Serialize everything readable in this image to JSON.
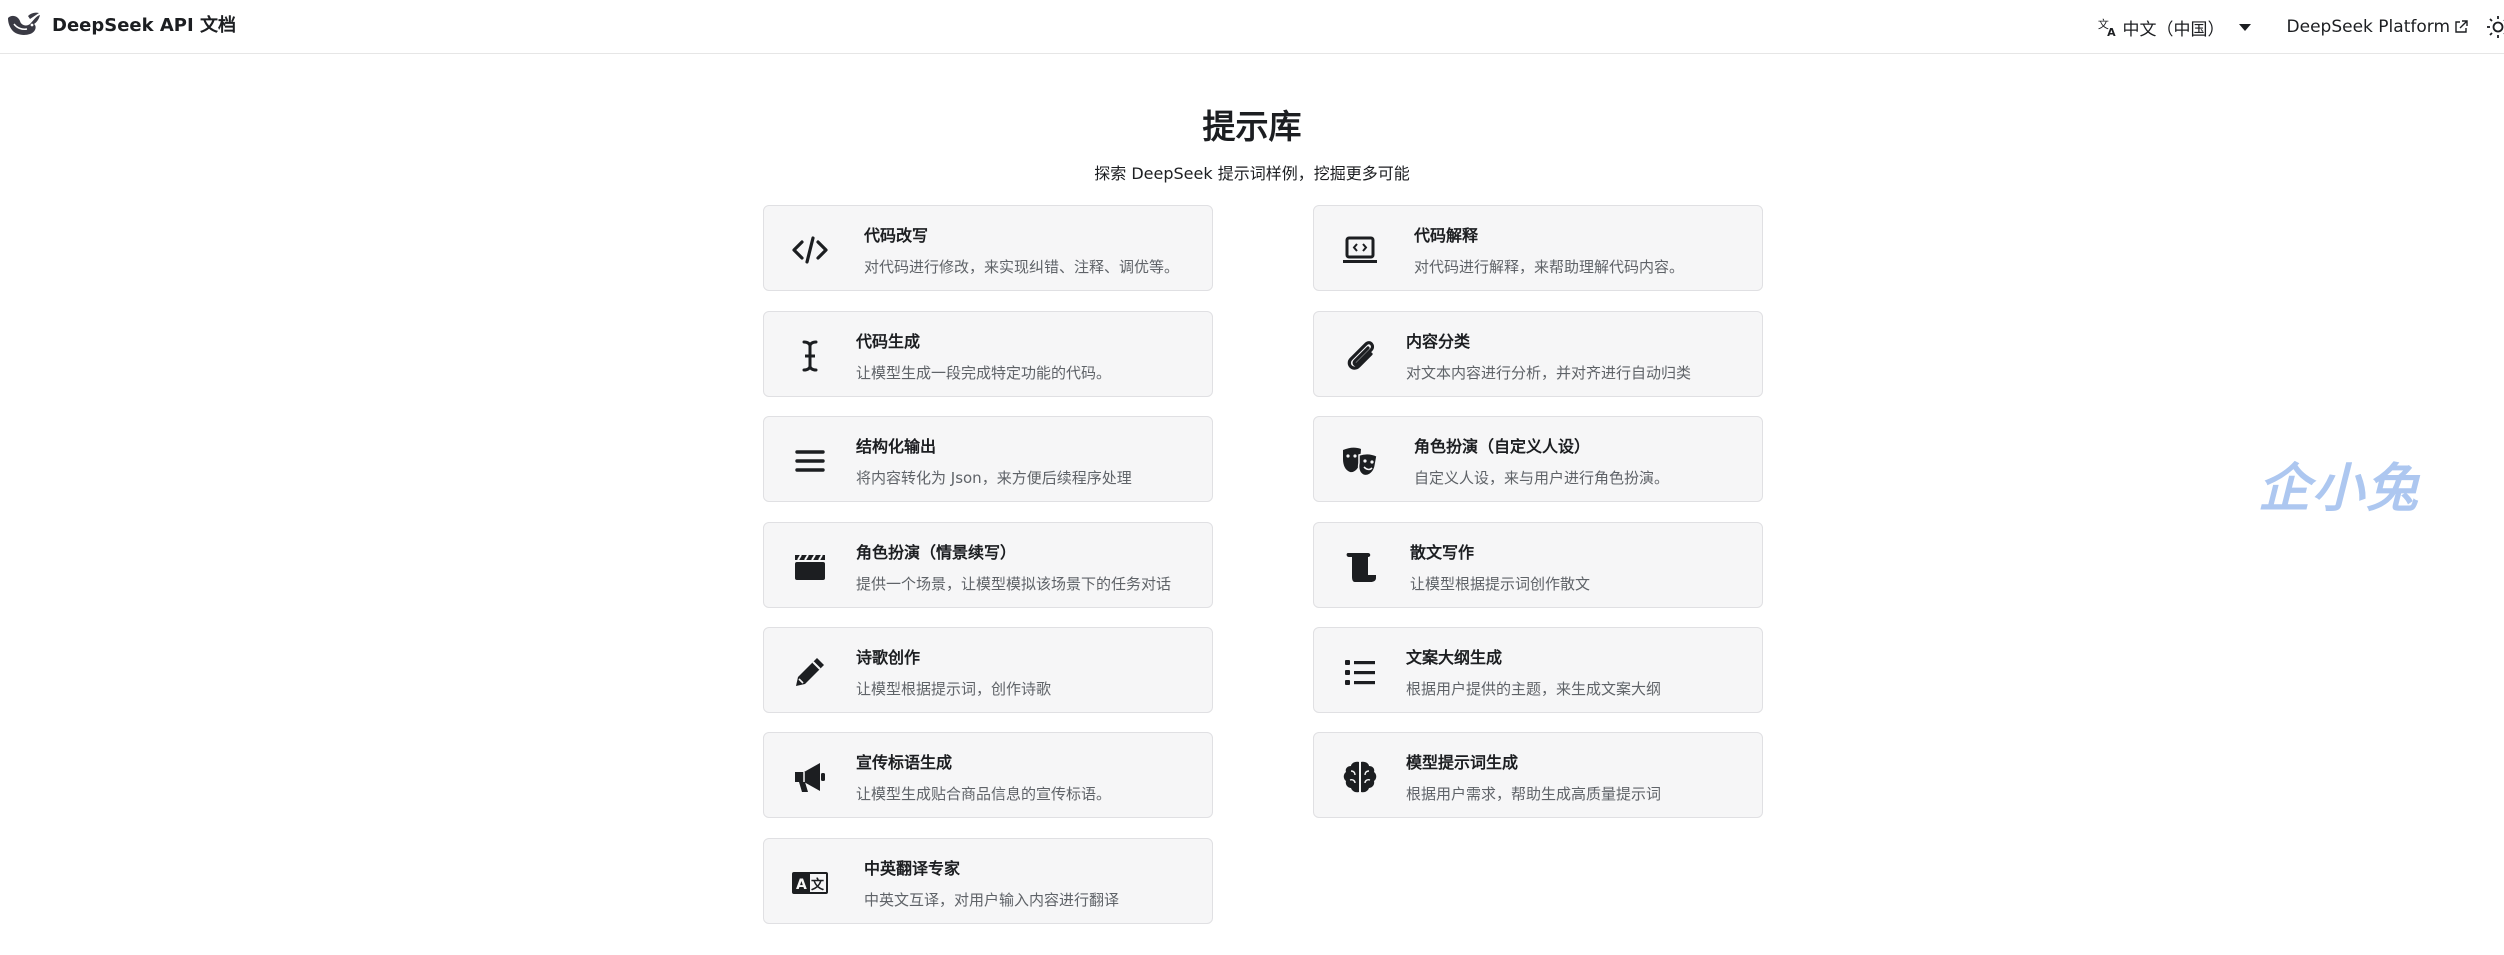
{
  "navbar": {
    "brand_title": "DeepSeek API 文档",
    "lang_label": "中文（中国）",
    "platform_label": "DeepSeek Platform"
  },
  "header": {
    "title": "提示库",
    "subtitle": "探索 DeepSeek 提示词样例，挖掘更多可能"
  },
  "cards": [
    {
      "title": "代码改写",
      "desc": "对代码进行修改，来实现纠错、注释、调优等。",
      "icon": "code-icon"
    },
    {
      "title": "代码解释",
      "desc": "对代码进行解释，来帮助理解代码内容。",
      "icon": "laptop-code-icon"
    },
    {
      "title": "代码生成",
      "desc": "让模型生成一段完成特定功能的代码。",
      "icon": "text-cursor-icon"
    },
    {
      "title": "内容分类",
      "desc": "对文本内容进行分析，并对齐进行自动归类",
      "icon": "paperclip-icon"
    },
    {
      "title": "结构化输出",
      "desc": "将内容转化为 Json，来方便后续程序处理",
      "icon": "menu-icon"
    },
    {
      "title": "角色扮演（自定义人设）",
      "desc": "自定义人设，来与用户进行角色扮演。",
      "icon": "theater-masks-icon"
    },
    {
      "title": "角色扮演（情景续写）",
      "desc": "提供一个场景，让模型模拟该场景下的任务对话",
      "icon": "clapperboard-icon"
    },
    {
      "title": "散文写作",
      "desc": "让模型根据提示词创作散文",
      "icon": "scroll-icon"
    },
    {
      "title": "诗歌创作",
      "desc": "让模型根据提示词，创作诗歌",
      "icon": "pen-icon"
    },
    {
      "title": "文案大纲生成",
      "desc": "根据用户提供的主题，来生成文案大纲",
      "icon": "list-icon"
    },
    {
      "title": "宣传标语生成",
      "desc": "让模型生成贴合商品信息的宣传标语。",
      "icon": "megaphone-icon"
    },
    {
      "title": "模型提示词生成",
      "desc": "根据用户需求，帮助生成高质量提示词",
      "icon": "brain-icon"
    },
    {
      "title": "中英翻译专家",
      "desc": "中英文互译，对用户输入内容进行翻译",
      "icon": "language-icon"
    }
  ],
  "watermark": "企小兔"
}
